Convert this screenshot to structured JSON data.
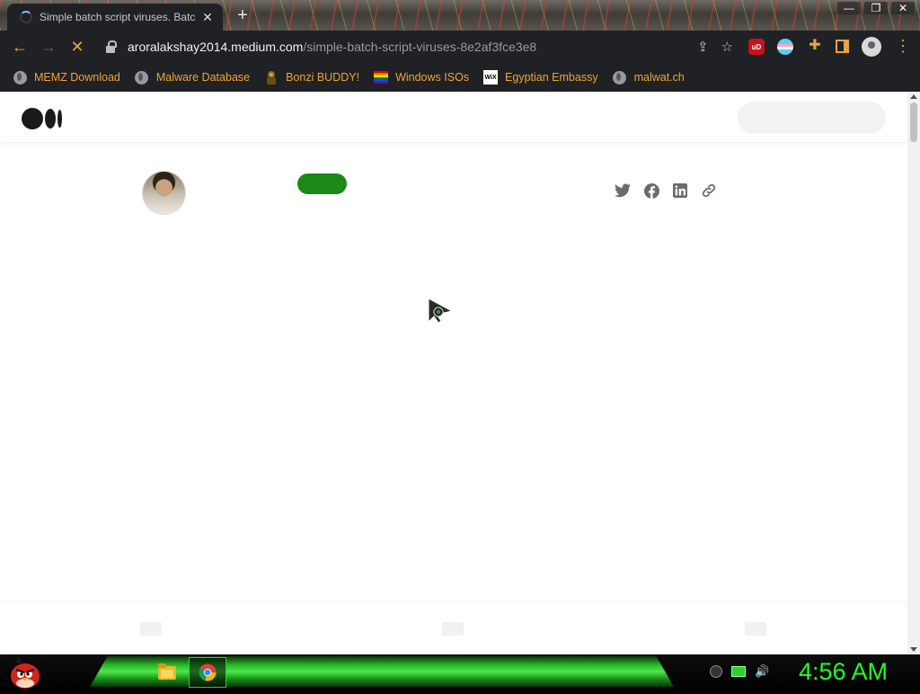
{
  "browser": {
    "tab": {
      "title": "Simple batch script viruses. Batc",
      "close_glyph": "✕",
      "new_tab_glyph": "+"
    },
    "window_controls": [
      "—",
      "❐",
      "✕"
    ],
    "toolbar": {
      "back_glyph": "←",
      "forward_glyph": "→",
      "stop_glyph": "✕",
      "url_host": "aroralakshay2014.medium.com",
      "url_path": "/simple-batch-script-viruses-8e2af3fce3e8",
      "share_glyph": "⇪",
      "star_glyph": "☆",
      "menu_glyph": "⋮"
    },
    "extensions": [
      {
        "name": "ublock-icon",
        "color": "#c3141b",
        "label": "uD"
      },
      {
        "name": "flag-extension-icon",
        "color": "#e8e8f0"
      },
      {
        "name": "puzzle-icon",
        "color": "#e8a33d"
      },
      {
        "name": "sidepanel-icon",
        "color": "#e8a33d"
      },
      {
        "name": "profile-icon",
        "color": "#d9d9d9"
      }
    ],
    "bookmarks": [
      {
        "label": "MEMZ Download",
        "icon": "globe-icon"
      },
      {
        "label": "Malware Database",
        "icon": "globe-icon"
      },
      {
        "label": "Bonzi BUDDY!",
        "icon": "bonzi-icon"
      },
      {
        "label": "Windows ISOs",
        "icon": "rainbow-flag-icon"
      },
      {
        "label": "Egyptian Embassy",
        "icon": "wix-icon"
      },
      {
        "label": "malwat.ch",
        "icon": "globe-icon"
      }
    ],
    "accent_color": "#f0a336"
  },
  "page": {
    "follow_color": "#1a8917",
    "share_icons": [
      "twitter-icon",
      "facebook-icon",
      "linkedin-icon",
      "link-icon"
    ]
  },
  "taskbar": {
    "clock": "4:56 AM",
    "clock_color": "#22ff22",
    "apps": [
      "file-explorer-icon",
      "chrome-icon"
    ],
    "tray": [
      "shield-tray-icon",
      "network-tray-icon",
      "volume-tray-icon"
    ]
  }
}
